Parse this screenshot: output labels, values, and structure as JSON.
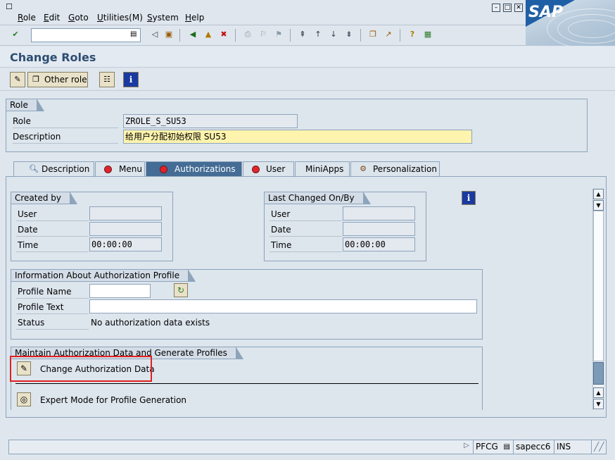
{
  "menubar": {
    "items": [
      {
        "label": "Role",
        "underline": "R"
      },
      {
        "label": "Edit",
        "underline": "E"
      },
      {
        "label": "Goto",
        "underline": "G"
      },
      {
        "label": "Utilities(M)",
        "underline": "U"
      },
      {
        "label": "System",
        "underline": "S"
      },
      {
        "label": "Help",
        "underline": "H"
      }
    ],
    "brand": "SAP"
  },
  "toolbar": {
    "command_value": "",
    "icons": [
      "enter-icon",
      "back-icon",
      "save-icon",
      "exit-icon",
      "cancel-icon",
      "print-icon",
      "find-icon",
      "find-next-icon",
      "first-page-icon",
      "previous-page-icon",
      "next-page-icon",
      "last-page-icon",
      "create-session-icon",
      "shortcut-icon",
      "help-icon",
      "layout-icon"
    ]
  },
  "title": "Change Roles",
  "app_toolbar": {
    "other_role_label": "Other role"
  },
  "role_group": {
    "title": "Role",
    "role_label": "Role",
    "role_value": "ZROLE_S_SU53",
    "description_label": "Description",
    "description_value": "给用户分配初始权限 SU53"
  },
  "tabs": [
    {
      "label": "Description",
      "active": false
    },
    {
      "label": "Menu",
      "active": false
    },
    {
      "label": "Authorizations",
      "active": true
    },
    {
      "label": "User",
      "active": false
    },
    {
      "label": "MiniApps",
      "active": false
    },
    {
      "label": "Personalization",
      "active": false
    }
  ],
  "created_by": {
    "title": "Created by",
    "user_label": "User",
    "user_value": "",
    "date_label": "Date",
    "date_value": "",
    "time_label": "Time",
    "time_value": "00:00:00"
  },
  "last_changed": {
    "title": "Last Changed On/By",
    "user_label": "User",
    "user_value": "",
    "date_label": "Date",
    "date_value": "",
    "time_label": "Time",
    "time_value": "00:00:00"
  },
  "auth_profile": {
    "title": "Information About Authorization Profile",
    "profile_name_label": "Profile Name",
    "profile_name_value": "",
    "profile_text_label": "Profile Text",
    "profile_text_value": "",
    "status_label": "Status",
    "status_value": "No authorization data exists"
  },
  "maintain": {
    "title": "Maintain Authorization Data and Generate Profiles",
    "change_label": "Change Authorization Data",
    "expert_label": "Expert Mode for Profile Generation"
  },
  "statusbar": {
    "transaction": "PFCG",
    "system": "sapecc6",
    "mode": "INS"
  }
}
